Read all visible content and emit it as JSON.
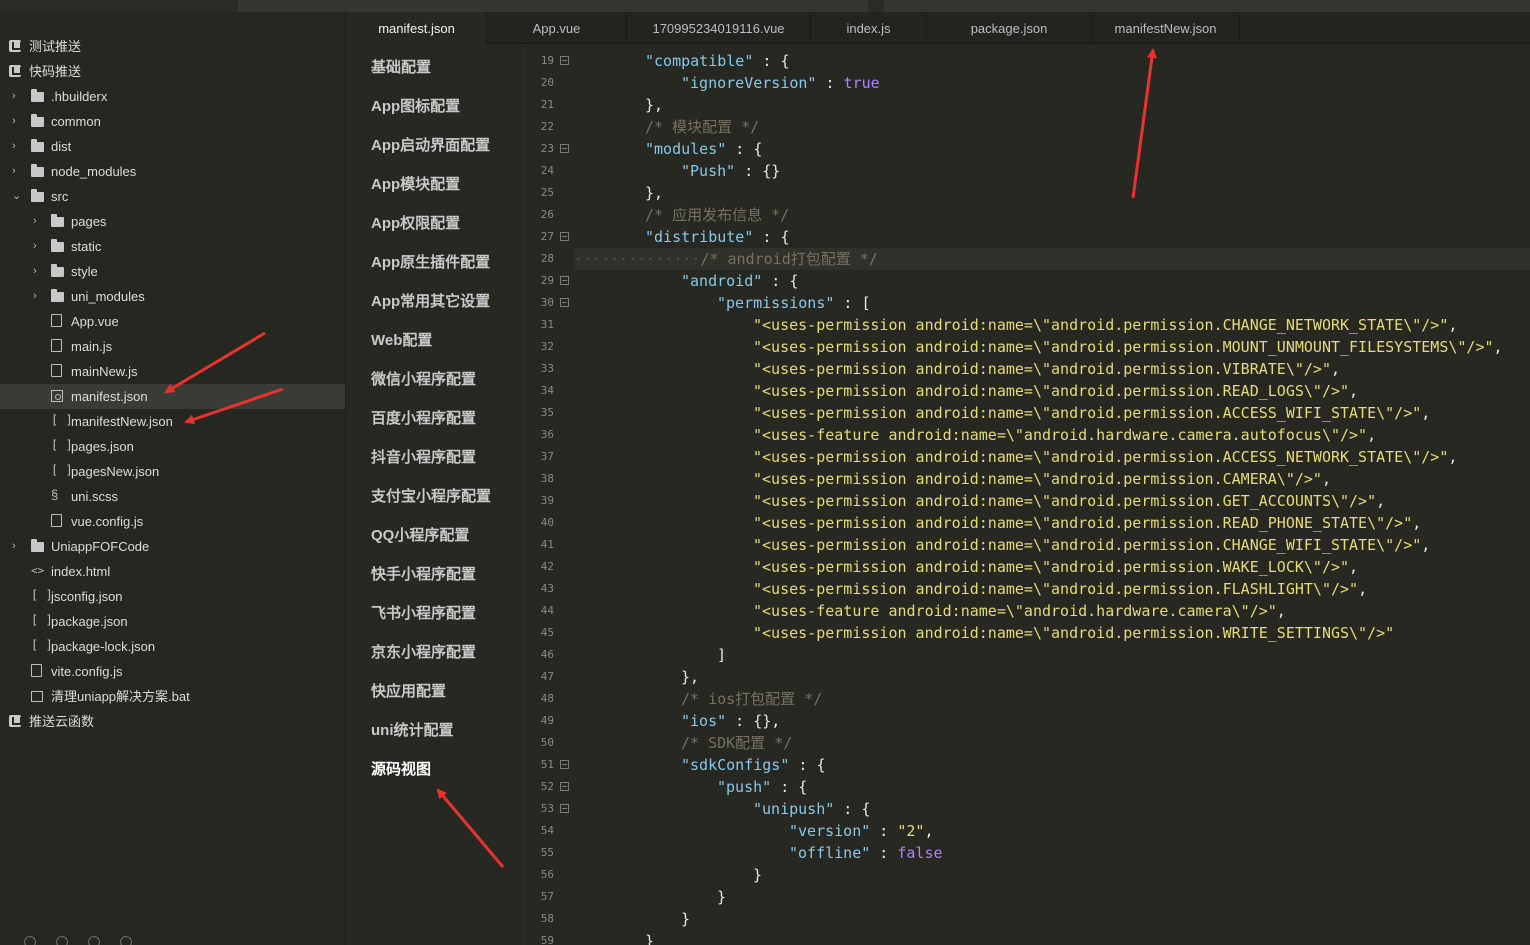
{
  "sidebar": {
    "items": [
      {
        "label": "测试推送",
        "icon": "project-icon",
        "depth": 0,
        "chevron": ""
      },
      {
        "label": "快码推送",
        "icon": "project-icon",
        "depth": 0,
        "chevron": ""
      },
      {
        "label": ".hbuilderx",
        "icon": "folder-icon",
        "depth": 1,
        "chevron": "›"
      },
      {
        "label": "common",
        "icon": "folder-icon",
        "depth": 1,
        "chevron": "›"
      },
      {
        "label": "dist",
        "icon": "folder-icon",
        "depth": 1,
        "chevron": "›"
      },
      {
        "label": "node_modules",
        "icon": "folder-icon",
        "depth": 1,
        "chevron": "›"
      },
      {
        "label": "src",
        "icon": "folder-icon",
        "depth": 1,
        "chevron": "⌄"
      },
      {
        "label": "pages",
        "icon": "folder-icon",
        "depth": 2,
        "chevron": "›"
      },
      {
        "label": "static",
        "icon": "folder-icon",
        "depth": 2,
        "chevron": "›"
      },
      {
        "label": "style",
        "icon": "folder-icon",
        "depth": 2,
        "chevron": "›"
      },
      {
        "label": "uni_modules",
        "icon": "folder-icon",
        "depth": 2,
        "chevron": "›"
      },
      {
        "label": "App.vue",
        "icon": "vue-file-icon",
        "depth": 2,
        "chevron": ""
      },
      {
        "label": "main.js",
        "icon": "js-file-icon",
        "depth": 2,
        "chevron": ""
      },
      {
        "label": "mainNew.js",
        "icon": "js-file-icon",
        "depth": 2,
        "chevron": ""
      },
      {
        "label": "manifest.json",
        "icon": "manifest-icon",
        "depth": 2,
        "chevron": "",
        "selected": true
      },
      {
        "label": "manifestNew.json",
        "icon": "json-file-icon",
        "depth": 2,
        "chevron": ""
      },
      {
        "label": "pages.json",
        "icon": "json-file-icon",
        "depth": 2,
        "chevron": ""
      },
      {
        "label": "pagesNew.json",
        "icon": "json-file-icon",
        "depth": 2,
        "chevron": ""
      },
      {
        "label": "uni.scss",
        "icon": "scss-file-icon",
        "depth": 2,
        "chevron": ""
      },
      {
        "label": "vue.config.js",
        "icon": "js-file-icon",
        "depth": 2,
        "chevron": ""
      },
      {
        "label": "UniappFOFCode",
        "icon": "folder-icon",
        "depth": 1,
        "chevron": "›"
      },
      {
        "label": "index.html",
        "icon": "html-file-icon",
        "depth": 1,
        "chevron": ""
      },
      {
        "label": "jsconfig.json",
        "icon": "json-file-icon",
        "depth": 1,
        "chevron": ""
      },
      {
        "label": "package.json",
        "icon": "json-file-icon",
        "depth": 1,
        "chevron": ""
      },
      {
        "label": "package-lock.json",
        "icon": "json-file-icon",
        "depth": 1,
        "chevron": ""
      },
      {
        "label": "vite.config.js",
        "icon": "js-file-icon",
        "depth": 1,
        "chevron": ""
      },
      {
        "label": "清理uniapp解决方案.bat",
        "icon": "bat-file-icon",
        "depth": 1,
        "chevron": ""
      },
      {
        "label": "推送云函数",
        "icon": "project-icon",
        "depth": 0,
        "chevron": ""
      }
    ]
  },
  "tabs": [
    {
      "label": "manifest.json",
      "active": true
    },
    {
      "label": "App.vue",
      "active": false
    },
    {
      "label": "170995234019116.vue",
      "active": false
    },
    {
      "label": "index.js",
      "active": false
    },
    {
      "label": "package.json",
      "active": false
    },
    {
      "label": "manifestNew.json",
      "active": false
    }
  ],
  "settings_nav": [
    {
      "label": "基础配置"
    },
    {
      "label": "App图标配置"
    },
    {
      "label": "App启动界面配置"
    },
    {
      "label": "App模块配置"
    },
    {
      "label": "App权限配置"
    },
    {
      "label": "App原生插件配置"
    },
    {
      "label": "App常用其它设置"
    },
    {
      "label": "Web配置"
    },
    {
      "label": "微信小程序配置"
    },
    {
      "label": "百度小程序配置"
    },
    {
      "label": "抖音小程序配置"
    },
    {
      "label": "支付宝小程序配置"
    },
    {
      "label": "QQ小程序配置"
    },
    {
      "label": "快手小程序配置"
    },
    {
      "label": "飞书小程序配置"
    },
    {
      "label": "京东小程序配置"
    },
    {
      "label": "快应用配置"
    },
    {
      "label": "uni统计配置"
    },
    {
      "label": "源码视图",
      "active": true
    }
  ],
  "editor": {
    "lines": [
      {
        "n": "19",
        "fold": true,
        "indent": 2,
        "parts": [
          [
            "key",
            "\"compatible\""
          ],
          [
            "p",
            " : {"
          ]
        ]
      },
      {
        "n": "20",
        "fold": false,
        "indent": 3,
        "parts": [
          [
            "key",
            "\"ignoreVersion\""
          ],
          [
            "p",
            " : "
          ],
          [
            "kw",
            "true"
          ]
        ]
      },
      {
        "n": "21",
        "fold": false,
        "indent": 2,
        "parts": [
          [
            "p",
            "},"
          ]
        ]
      },
      {
        "n": "22",
        "fold": false,
        "indent": 2,
        "parts": [
          [
            "cm",
            "/* 模块配置 */"
          ]
        ]
      },
      {
        "n": "23",
        "fold": true,
        "indent": 2,
        "parts": [
          [
            "key",
            "\"modules\""
          ],
          [
            "p",
            " : {"
          ]
        ]
      },
      {
        "n": "24",
        "fold": false,
        "indent": 3,
        "parts": [
          [
            "key",
            "\"Push\""
          ],
          [
            "p",
            " : {}"
          ]
        ]
      },
      {
        "n": "25",
        "fold": false,
        "indent": 2,
        "parts": [
          [
            "p",
            "},"
          ]
        ]
      },
      {
        "n": "26",
        "fold": false,
        "indent": 2,
        "parts": [
          [
            "cm",
            "/* 应用发布信息 */"
          ]
        ]
      },
      {
        "n": "27",
        "fold": true,
        "indent": 2,
        "parts": [
          [
            "key",
            "\"distribute\""
          ],
          [
            "p",
            " : {"
          ]
        ]
      },
      {
        "n": "28",
        "fold": false,
        "indent": 0,
        "highlight": true,
        "parts": [
          [
            "dots",
            "··············"
          ],
          [
            "cm",
            "/* android打包配置 */"
          ]
        ]
      },
      {
        "n": "29",
        "fold": true,
        "indent": 3,
        "parts": [
          [
            "key",
            "\"android\""
          ],
          [
            "p",
            " : {"
          ]
        ]
      },
      {
        "n": "30",
        "fold": true,
        "indent": 4,
        "parts": [
          [
            "key",
            "\"permissions\""
          ],
          [
            "p",
            " : ["
          ]
        ]
      },
      {
        "n": "31",
        "fold": false,
        "indent": 5,
        "parts": [
          [
            "str",
            "\"<uses-permission android:name=\\\"android.permission.CHANGE_NETWORK_STATE\\\"/>\""
          ],
          [
            "p",
            ","
          ]
        ]
      },
      {
        "n": "32",
        "fold": false,
        "indent": 5,
        "parts": [
          [
            "str",
            "\"<uses-permission android:name=\\\"android.permission.MOUNT_UNMOUNT_FILESYSTEMS\\\"/>\""
          ],
          [
            "p",
            ","
          ]
        ]
      },
      {
        "n": "33",
        "fold": false,
        "indent": 5,
        "parts": [
          [
            "str",
            "\"<uses-permission android:name=\\\"android.permission.VIBRATE\\\"/>\""
          ],
          [
            "p",
            ","
          ]
        ]
      },
      {
        "n": "34",
        "fold": false,
        "indent": 5,
        "parts": [
          [
            "str",
            "\"<uses-permission android:name=\\\"android.permission.READ_LOGS\\\"/>\""
          ],
          [
            "p",
            ","
          ]
        ]
      },
      {
        "n": "35",
        "fold": false,
        "indent": 5,
        "parts": [
          [
            "str",
            "\"<uses-permission android:name=\\\"android.permission.ACCESS_WIFI_STATE\\\"/>\""
          ],
          [
            "p",
            ","
          ]
        ]
      },
      {
        "n": "36",
        "fold": false,
        "indent": 5,
        "parts": [
          [
            "str",
            "\"<uses-feature android:name=\\\"android.hardware.camera.autofocus\\\"/>\""
          ],
          [
            "p",
            ","
          ]
        ]
      },
      {
        "n": "37",
        "fold": false,
        "indent": 5,
        "parts": [
          [
            "str",
            "\"<uses-permission android:name=\\\"android.permission.ACCESS_NETWORK_STATE\\\"/>\""
          ],
          [
            "p",
            ","
          ]
        ]
      },
      {
        "n": "38",
        "fold": false,
        "indent": 5,
        "parts": [
          [
            "str",
            "\"<uses-permission android:name=\\\"android.permission.CAMERA\\\"/>\""
          ],
          [
            "p",
            ","
          ]
        ]
      },
      {
        "n": "39",
        "fold": false,
        "indent": 5,
        "parts": [
          [
            "str",
            "\"<uses-permission android:name=\\\"android.permission.GET_ACCOUNTS\\\"/>\""
          ],
          [
            "p",
            ","
          ]
        ]
      },
      {
        "n": "40",
        "fold": false,
        "indent": 5,
        "parts": [
          [
            "str",
            "\"<uses-permission android:name=\\\"android.permission.READ_PHONE_STATE\\\"/>\""
          ],
          [
            "p",
            ","
          ]
        ]
      },
      {
        "n": "41",
        "fold": false,
        "indent": 5,
        "parts": [
          [
            "str",
            "\"<uses-permission android:name=\\\"android.permission.CHANGE_WIFI_STATE\\\"/>\""
          ],
          [
            "p",
            ","
          ]
        ]
      },
      {
        "n": "42",
        "fold": false,
        "indent": 5,
        "parts": [
          [
            "str",
            "\"<uses-permission android:name=\\\"android.permission.WAKE_LOCK\\\"/>\""
          ],
          [
            "p",
            ","
          ]
        ]
      },
      {
        "n": "43",
        "fold": false,
        "indent": 5,
        "parts": [
          [
            "str",
            "\"<uses-permission android:name=\\\"android.permission.FLASHLIGHT\\\"/>\""
          ],
          [
            "p",
            ","
          ]
        ]
      },
      {
        "n": "44",
        "fold": false,
        "indent": 5,
        "parts": [
          [
            "str",
            "\"<uses-feature android:name=\\\"android.hardware.camera\\\"/>\""
          ],
          [
            "p",
            ","
          ]
        ]
      },
      {
        "n": "45",
        "fold": false,
        "indent": 5,
        "parts": [
          [
            "str",
            "\"<uses-permission android:name=\\\"android.permission.WRITE_SETTINGS\\\"/>\""
          ]
        ]
      },
      {
        "n": "46",
        "fold": false,
        "indent": 4,
        "parts": [
          [
            "p",
            "]"
          ]
        ]
      },
      {
        "n": "47",
        "fold": false,
        "indent": 3,
        "parts": [
          [
            "p",
            "},"
          ]
        ]
      },
      {
        "n": "48",
        "fold": false,
        "indent": 3,
        "parts": [
          [
            "cm",
            "/* ios打包配置 */"
          ]
        ]
      },
      {
        "n": "49",
        "fold": false,
        "indent": 3,
        "parts": [
          [
            "key",
            "\"ios\""
          ],
          [
            "p",
            " : {},"
          ]
        ]
      },
      {
        "n": "50",
        "fold": false,
        "indent": 3,
        "parts": [
          [
            "cm",
            "/* SDK配置 */"
          ]
        ]
      },
      {
        "n": "51",
        "fold": true,
        "indent": 3,
        "parts": [
          [
            "key",
            "\"sdkConfigs\""
          ],
          [
            "p",
            " : {"
          ]
        ]
      },
      {
        "n": "52",
        "fold": true,
        "indent": 4,
        "parts": [
          [
            "key",
            "\"push\""
          ],
          [
            "p",
            " : {"
          ]
        ]
      },
      {
        "n": "53",
        "fold": true,
        "indent": 5,
        "parts": [
          [
            "key",
            "\"unipush\""
          ],
          [
            "p",
            " : {"
          ]
        ]
      },
      {
        "n": "54",
        "fold": false,
        "indent": 6,
        "parts": [
          [
            "key",
            "\"version\""
          ],
          [
            "p",
            " : "
          ],
          [
            "str",
            "\"2\""
          ],
          [
            "p",
            ","
          ]
        ]
      },
      {
        "n": "55",
        "fold": false,
        "indent": 6,
        "parts": [
          [
            "key",
            "\"offline\""
          ],
          [
            "p",
            " : "
          ],
          [
            "kw",
            "false"
          ]
        ]
      },
      {
        "n": "56",
        "fold": false,
        "indent": 5,
        "parts": [
          [
            "p",
            "}"
          ]
        ]
      },
      {
        "n": "57",
        "fold": false,
        "indent": 4,
        "parts": [
          [
            "p",
            "}"
          ]
        ]
      },
      {
        "n": "58",
        "fold": false,
        "indent": 3,
        "parts": [
          [
            "p",
            "}"
          ]
        ]
      },
      {
        "n": "59",
        "fold": false,
        "indent": 2,
        "parts": [
          [
            "p",
            "}"
          ]
        ]
      }
    ]
  },
  "colors": {
    "editor_bg": "#272822",
    "key": "#88c8e8",
    "string": "#e6db74",
    "comment": "#75715e",
    "constant": "#ae81ff",
    "annotation_arrow": "#e8322e"
  }
}
